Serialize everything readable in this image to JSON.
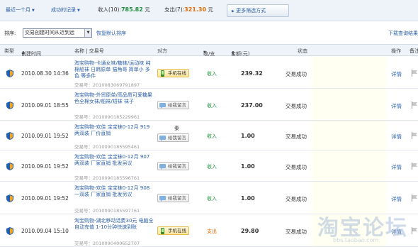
{
  "filters": {
    "period": "最近一个月",
    "record_type": "成功的记录",
    "income_label": "收入(10):",
    "income_amount": "785.82",
    "income_unit": "元",
    "expense_label": "支出(7):",
    "expense_amount": "321.30",
    "expense_unit": "元",
    "more_button": "更多筛选方式"
  },
  "sort": {
    "label": "排序:",
    "selected": "交易创建时间从近到远",
    "restore": "恢复默认排序",
    "download": "下载查询结果"
  },
  "table": {
    "headers": {
      "type": "类型",
      "created": "创建时间",
      "name": "名称 | 交易号",
      "counterparty": "对方",
      "direction": "收/支",
      "amount": "金额(元)",
      "status": "状态",
      "action": "操作",
      "note": "备注"
    },
    "rows": [
      {
        "time": "2010.08.30 14:36",
        "name": "淘宝购物-卡通女袜/糖袜/运动袜 纯棉船袜 日韩原单 猫角哥 简单小 多色 等多件",
        "order_label": "交易号：",
        "order_no": "2010083069791897",
        "counterparty_button": "手机在线",
        "direction": "收入",
        "amount": "239.32",
        "status": "交易成功",
        "action": "详情"
      },
      {
        "time": "2010.09.01 18:55",
        "name": "淘宝购物-外贸原单/高品质可爱糖果色全棉女袜/船袜/短袜 袜子",
        "order_label": "交易号：",
        "order_no": "2010090185229961",
        "counterparty_button": "给我留言",
        "direction": "收入",
        "amount": "237.00",
        "status": "交易成功",
        "action": "详情"
      },
      {
        "time": "2010.09.01 19:52",
        "name": "淘宝购物-欢佳 宝宝袜0-12月 919 两双装 厂价直销",
        "order_label": "交易号：",
        "order_no": "2010090185595461",
        "counterparty_name": "秦",
        "counterparty_button": "给我留言",
        "direction": "收入",
        "amount": "1.00",
        "status": "交易成功",
        "action": "详情"
      },
      {
        "time": "2010.09.01 19:52",
        "name": "淘宝购物-欢佳 宝宝袜0-12月 907 两双装 厂家直销 批发另议",
        "order_label": "交易号：",
        "order_no": "2010090185596761",
        "counterparty_button": "给我留言",
        "direction": "收入",
        "amount": "1.00",
        "status": "交易成功",
        "action": "详情"
      },
      {
        "time": "2010.09.01 19:52",
        "name": "淘宝购物-欢佳 宝宝袜0-12月 908 一双装 厂家直销 批发另议",
        "order_label": "交易号：",
        "order_no": "2010090185597761",
        "counterparty_button": "给我留言",
        "direction": "收入",
        "amount": "1.00",
        "status": "交易成功",
        "action": "详情"
      },
      {
        "time": "2010.09.04 15:10",
        "name": "淘宝购物-湖北移动话费30元 电脑全自动充值 1-10分钟快速到账",
        "order_label": "交易号：",
        "order_no": "2010090400652707",
        "counterparty_button": "手机在线",
        "direction": "支出",
        "amount": "29.80",
        "status": "交易成功",
        "action": "详情"
      }
    ]
  },
  "watermark": {
    "text": "淘宝论坛",
    "url": "bbs.taobao.com"
  },
  "colors": {
    "link": "#2b5fa8",
    "income": "#1d8f3a",
    "expense": "#e36b00",
    "header_bg": "#eef3fa"
  }
}
